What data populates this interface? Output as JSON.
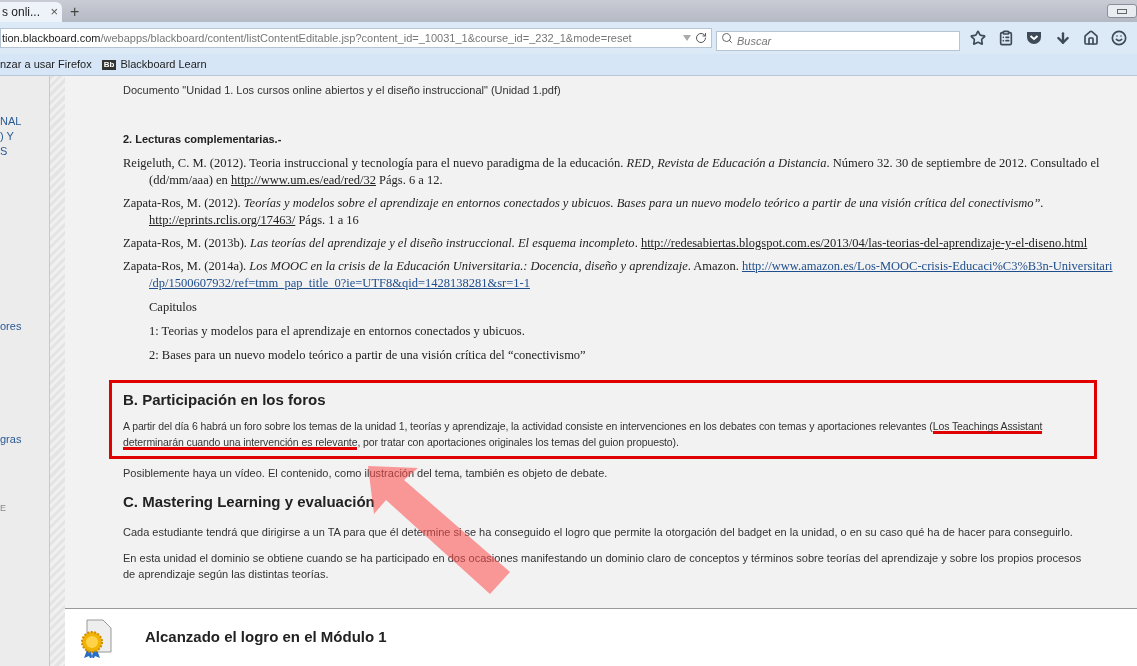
{
  "browser": {
    "tab": {
      "title": "s onli...",
      "close": "×",
      "selected": true
    },
    "new_tab": "+",
    "url": {
      "host": "tion.blackboard.com",
      "path": "/webapps/blackboard/content/listContentEditable.jsp?content_id=_10031_1&course_id=_232_1&mode=reset"
    },
    "search": {
      "placeholder": "Buscar"
    },
    "bookmarks": [
      {
        "label": "nzar a usar Firefox",
        "kind": "text"
      },
      {
        "label": "Blackboard Learn",
        "kind": "logo",
        "logo": "Bb"
      }
    ]
  },
  "sidebar": {
    "items": [
      {
        "label": "NAL"
      },
      {
        "label": ") Y"
      },
      {
        "label": "S"
      },
      {
        "label": "ores"
      },
      {
        "label": "gras"
      },
      {
        "label": "E"
      }
    ]
  },
  "content": {
    "document_line": "Documento  \"Unidad 1. Los cursos online abiertos y el diseño instruccional\" (Unidad 1.pdf)",
    "readings_heading": "2.  Lecturas complementarias.-",
    "references": [
      {
        "text": "Reigeluth, C. M. (2012).  Teoria instruccional y tecnología para el nuevo paradigma de la educación. *RED, Revista de Educación a Distancia*. Número 32. 30 de septiembre de 2012. Consultado el (dd/mm/aaa) en ",
        "link": "http://www.um.es/ead/red/32",
        "after": " Págs. 6 a 12."
      },
      {
        "text": "Zapata-Ros, M. (2012). *Teorías y modelos sobre el aprendizaje en entornos conectados y ubicuos. Bases para un nuevo modelo teórico a partir de una visión crítica del conectivismo”.* ",
        "link": "http://eprints.rclis.org/17463/",
        "after": " Págs. 1 a 16"
      },
      {
        "text": "Zapata-Ros, M. (2013b). *Las teorías del aprendizaje y el diseño instruccional. El esquema incompleto*. ",
        "link": "http://redesabiertas.blogspot.com.es/2013/04/las-teorias-del-aprendizaje-y-el-diseno.html"
      },
      {
        "text": "Zapata-Ros, M. (2014a).  *Los MOOC en la crisis de la Educación Universitaria.: Docencia, diseño y aprendizaje*. Amazon. ",
        "link": "http://www.amazon.es/Los-MOOC-crisis-Educaci%C3%B3n-Universitari",
        "link_continued": "/dp/1500607932/ref=tmm_pap_title_0?ie=UTF8&qid=1428138281&sr=1-1"
      }
    ],
    "chapters_label": "Capitulos",
    "chapters": [
      "1: Teorias y modelos para el aprendizaje en entornos conectados y ubicuos.",
      "2: Bases para un nuevo modelo teórico a partir de una visión crítica del “conectivismo”"
    ],
    "section_b": {
      "heading": "B. Participación en los foros",
      "highlighted_box": true,
      "segments": [
        {
          "text": "A partir del día 6 habrá un foro sobre los temas de la unidad 1, teorías y aprendizaje, la actividad consiste en intervenciones en los debates con temas y aportaciones relevantes  (",
          "underlined": false
        },
        {
          "text": "Los Teachings Assistant",
          "underlined": true
        },
        {
          "text": "determinarán cuando una intervención es relevante",
          "underlined": true
        },
        {
          "text": ", por tratar con aportaciones originales los temas del guion propuesto).",
          "underlined": false
        }
      ]
    },
    "video_note": "Posiblemente haya un vídeo. El contenido, como ilustración del tema, también es objeto de debate.",
    "section_c": {
      "heading": "C. Mastering Learning y evaluación",
      "paragraphs": [
        "Cada estudiante tendrá que dirigirse a un TA para que él determine si se ha conseguido el logro que permite la otorgación del badget en la unidad, o en su caso qué ha de hacer para conseguirlo.",
        "En esta unidad el dominio se obtiene cuando se ha participado en dos ocasiones manifestando un dominio claro de conceptos y términos sobre teorías del aprendizaje y sobre los propios procesos de aprendizaje según las distintas teorías."
      ]
    },
    "achievement": {
      "title": "Alcanzado el logro en el Módulo 1"
    }
  }
}
